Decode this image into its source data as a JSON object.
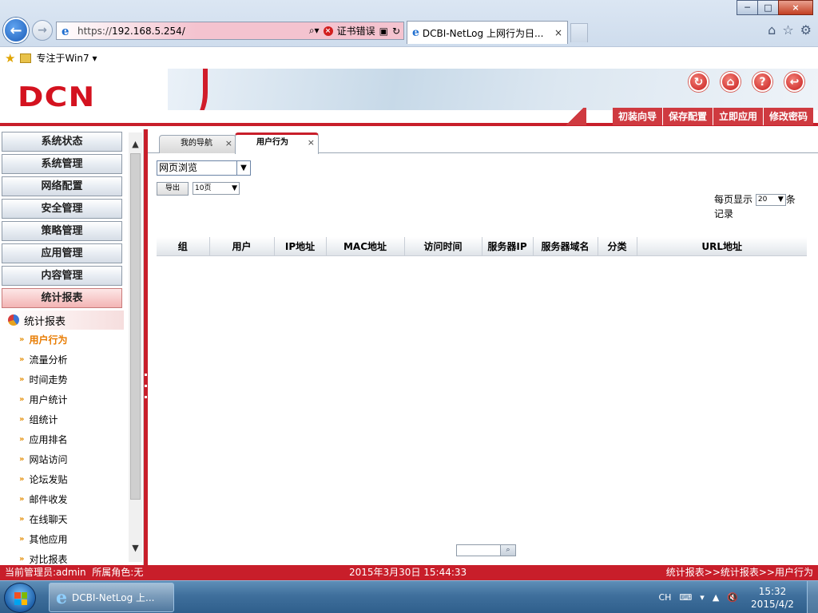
{
  "browser": {
    "url_prefix": "https://",
    "url_domain": "192.168.5.254/",
    "search_icon": "search-icon",
    "cert_error_label": "证书错误",
    "tab_title": "DCBI-NetLog 上网行为日...",
    "tab_close": "×",
    "favorites_item": "专注于Win7",
    "back_glyph": "←",
    "forward_glyph": "→",
    "minimize_glyph": "─",
    "maximize_glyph": "□",
    "close_glyph": "×"
  },
  "app": {
    "logo": "DCN",
    "header_links": [
      "初装向导",
      "保存配置",
      "立即应用",
      "修改密码"
    ],
    "header_icons": [
      "refresh-icon",
      "home-icon",
      "help-icon",
      "logout-icon"
    ]
  },
  "sidebar": {
    "menu": [
      "系统状态",
      "系统管理",
      "网络配置",
      "安全管理",
      "策略管理",
      "应用管理",
      "内容管理",
      "统计报表"
    ],
    "active_menu": "统计报表",
    "sub_header": "统计报表",
    "sub_items": [
      "用户行为",
      "流量分析",
      "时间走势",
      "用户统计",
      "组统计",
      "应用排名",
      "网站访问",
      "论坛发贴",
      "邮件收发",
      "在线聊天",
      "其他应用",
      "对比报表"
    ],
    "active_sub_item": "用户行为"
  },
  "main": {
    "tabs": [
      {
        "label": "我的导航",
        "close": "×"
      },
      {
        "label": "用户行为",
        "close": "×"
      }
    ],
    "type_select": "网页浏览",
    "export_label": "导出",
    "pages_select": "10页",
    "per_page_label": "每页显示",
    "per_page_value": "20",
    "per_page_suffix": "条",
    "per_page_unit": "记录",
    "table_headers": [
      "组",
      "用户",
      "IP地址",
      "MAC地址",
      "访问时间",
      "服务器IP",
      "服务器域名",
      "分类",
      "URL地址"
    ],
    "page_search_value": ""
  },
  "status": {
    "admin": "当前管理员:admin",
    "role": "所属角色:无",
    "time": "2015年3月30日 15:44:33",
    "breadcrumb": "统计报表>>统计报表>>用户行为"
  },
  "taskbar": {
    "item": "DCBI-NetLog 上...",
    "lang": "CH",
    "time": "15:32",
    "date": "2015/4/2"
  },
  "colors": {
    "brand_red": "#c81e2a",
    "active_sub": "#e87b00"
  }
}
